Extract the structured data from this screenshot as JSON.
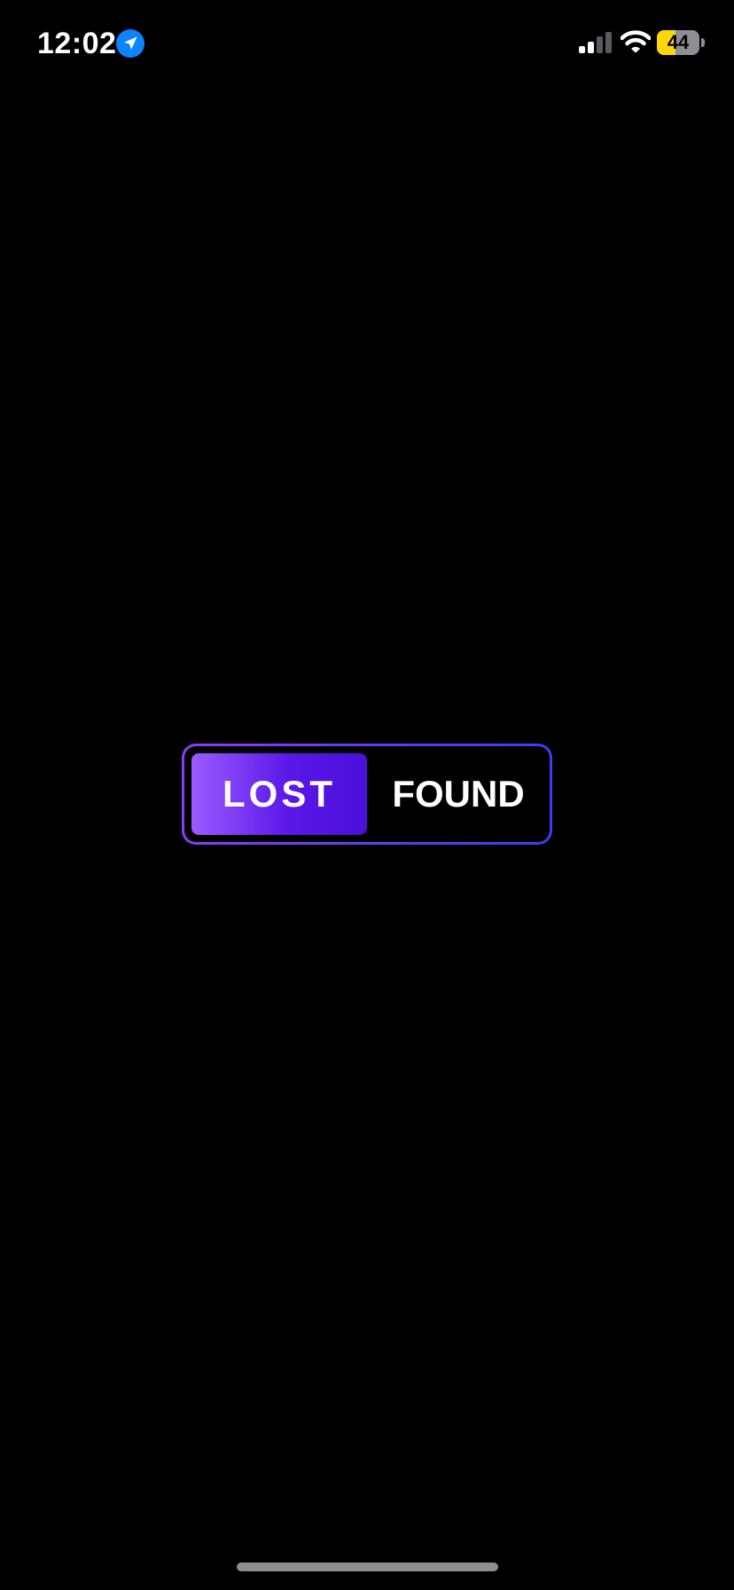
{
  "status_bar": {
    "time": "12:02",
    "battery_level": "44",
    "battery_fraction": 0.44,
    "battery_fill_color": "#ffd60a",
    "location_icon_color": "#0a84ff"
  },
  "toggle": {
    "options": [
      {
        "label": "LOST",
        "selected": true
      },
      {
        "label": "FOUND",
        "selected": false
      }
    ],
    "border_gradient": [
      "#8b3cf7",
      "#3b3ef0"
    ],
    "selected_gradient": [
      "#9b5bff",
      "#4a0fd9"
    ]
  }
}
